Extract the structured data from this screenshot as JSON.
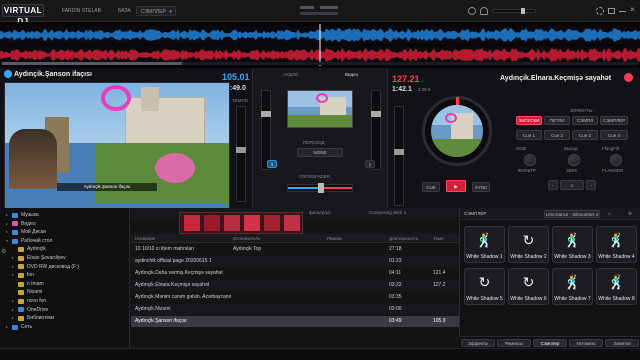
{
  "app": {
    "logo": "VIRTUAL DJ"
  },
  "topbar": {
    "user": "FARDIN STELAB",
    "mode_label": "БАЗА",
    "mode_value": "СЭМПЛЕР",
    "icons": [
      "record-icon",
      "headphones-icon",
      "settings-icon",
      "fullscreen-icon",
      "minimize-icon",
      "close-icon"
    ]
  },
  "deckA": {
    "title": "Aydınçik.Şanson ifaçısı",
    "bpm": "105.01",
    "time": "3:49.0",
    "video_caption": "Aydınçik.Şanson ifaçısı",
    "color": "#2fa8ff",
    "labels": {
      "pitch": "ТЕМПО",
      "sync": "SYNC"
    }
  },
  "deckB": {
    "title": "Aydınçik.Elnara.Keçmişə sayahət",
    "bpm": "127.21",
    "time": "1:42.1",
    "elapsed": "3:26.8",
    "color": "#ff3d55",
    "loop_header": "ЭФФЕКТЫ",
    "effects": [
      "Smth",
      "Выход",
      "FlangFilt"
    ],
    "hotcues_tabs": [
      "ЗАПУСКИ",
      "ПЕТЛИ",
      "СЭМПЛ",
      "СЭМПЛЕР"
    ],
    "hotcues": [
      "Cue 1",
      "Cue 2",
      "Cue 3",
      "Cue 4"
    ],
    "transport": [
      "CUE",
      "▶",
      "SYNC"
    ],
    "loop_value": "1",
    "knob_labels": [
      "ФИЛЬТР",
      "ЗВУК",
      "FLANGER"
    ]
  },
  "mixer": {
    "audio_label": "АУДИО",
    "video_label": "Видео",
    "transition_label": "ПЕРЕХОД",
    "transition_value": "NONE",
    "crossfader_label": "CROSSFADER"
  },
  "browser": {
    "search_placeholder": "фильтр(ы)",
    "status": "Composing deck 1",
    "tree": [
      {
        "label": "Музыка",
        "icon": "music-folder-icon",
        "color": "blue",
        "arrow": "▸"
      },
      {
        "label": "Видео",
        "icon": "video-folder-icon",
        "color": "pink",
        "arrow": "▸"
      },
      {
        "label": "Мой Диски",
        "icon": "disc-folder-icon",
        "color": "blue",
        "arrow": "▸"
      },
      {
        "label": "Рабочий стол",
        "icon": "desktop-folder-icon",
        "color": "blue",
        "arrow": "▾"
      },
      {
        "label": "Aydınçik",
        "icon": "folder-icon",
        "color": "yellow",
        "arrow": ""
      },
      {
        "label": "Elxan Şovardiyev",
        "icon": "folder-icon",
        "color": "yellow",
        "arrow": "▸"
      },
      {
        "label": "DVD RW дисковод (F:)",
        "icon": "drive-icon",
        "color": "yellow",
        "arrow": "▸"
      },
      {
        "label": "fon",
        "icon": "folder-icon",
        "color": "yellow",
        "arrow": "▸"
      },
      {
        "label": "n Imam",
        "icon": "folder-icon",
        "color": "yellow",
        "arrow": ""
      },
      {
        "label": "Nizami",
        "icon": "folder-icon",
        "color": "yellow",
        "arrow": ""
      },
      {
        "label": "novo fon",
        "icon": "folder-icon",
        "color": "yellow",
        "arrow": "▸"
      },
      {
        "label": "OneDrive",
        "icon": "folder-icon",
        "color": "blue",
        "arrow": "▸"
      },
      {
        "label": "Библиотеки",
        "icon": "folder-icon",
        "color": "yellow",
        "arrow": "▸"
      },
      {
        "label": "Сеть",
        "icon": "network-icon",
        "color": "blue",
        "arrow": "▸"
      }
    ],
    "columns": [
      "Название",
      "Исполнитель",
      "Ремикс",
      "Длительность",
      "Темп"
    ],
    "rows": [
      {
        "title": "10 10/10 cı ibem mahnıları",
        "artist": "Aydınçik Top",
        "remix": "",
        "length": "27:18",
        "bpm": "",
        "selected": false
      },
      {
        "title": "aydinchik official page 20200615 1",
        "artist": "",
        "remix": "",
        "length": "01:23",
        "bpm": "",
        "selected": false
      },
      {
        "title": "Aydınçik.Daha varmiş.Keçmişə sayahət",
        "artist": "",
        "remix": "",
        "length": "04:11",
        "bpm": "121.4",
        "selected": false
      },
      {
        "title": "Aydınçik.Elnara.Keçmişə sayahət",
        "artist": "",
        "remix": "",
        "length": "03:22",
        "bpm": "127.2",
        "selected": false
      },
      {
        "title": "Aydınçik.Mənim canım gəlsin. Azərbaycanım",
        "artist": "",
        "remix": "",
        "length": "03:35",
        "bpm": "",
        "selected": false
      },
      {
        "title": "Aydınçik.Nizami",
        "artist": "",
        "remix": "",
        "length": "03:00",
        "bpm": "",
        "selected": false
      },
      {
        "title": "Aydınçik.Şanson ifaçısı",
        "artist": "",
        "remix": "",
        "length": "03:49",
        "bpm": "105.0",
        "selected": true
      }
    ]
  },
  "sampler": {
    "header": "СЭМПЛЕР",
    "bank": "Lets Dance - Silhouettes 2",
    "pads": [
      {
        "label": "White Shadow 1",
        "icon": "dancer-icon",
        "glyph": "🕺"
      },
      {
        "label": "White Shadow 2",
        "icon": "loop-icon",
        "glyph": "↻"
      },
      {
        "label": "White Shadow 3",
        "icon": "dancer-icon",
        "glyph": "🕺"
      },
      {
        "label": "White Shadow 4",
        "icon": "dancer-icon",
        "glyph": "🕺"
      },
      {
        "label": "White Shadow 5",
        "icon": "loop-icon",
        "glyph": "↻"
      },
      {
        "label": "White Shadow 6",
        "icon": "loop-icon",
        "glyph": "↻"
      },
      {
        "label": "White Shadow 7",
        "icon": "dancer-icon",
        "glyph": "🕺"
      },
      {
        "label": "White Shadow 8",
        "icon": "dancer-icon",
        "glyph": "🕺"
      }
    ],
    "footer_tabs": [
      "Эффекты",
      "Ремиксы",
      "Сэмплер",
      "Автомикс",
      "Заметки"
    ]
  }
}
